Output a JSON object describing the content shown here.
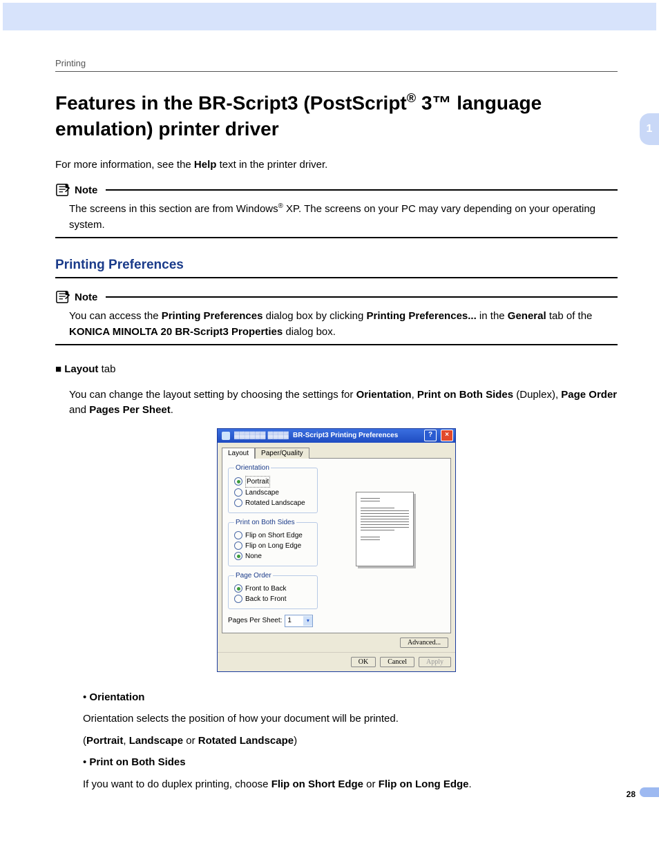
{
  "section_label": "Printing",
  "chapter_number": "1",
  "page_number": "28",
  "main_title_html": "Features in the BR-Script3 (PostScript<sup class='sup'>®</sup> 3™ language emulation) printer driver",
  "intro_html": "For more information, see the <b>Help</b> text in the printer driver.",
  "note1_label": "Note",
  "note1_body_html": "The screens in this section are from Windows<sup class='sup'>®</sup> XP. The screens on your PC may vary depending on your operating system.",
  "sub_title": "Printing Preferences",
  "note2_label": "Note",
  "note2_body_html": "You can access the <b>Printing Preferences</b> dialog box by clicking <b>Printing Preferences...</b> in the <b>General</b> tab of the <b>KONICA MINOLTA 20 BR-Script3 Properties</b> dialog box.",
  "layout_tab_heading_html": "<b>Layout</b> tab",
  "layout_tab_body_html": "You can change the layout setting by choosing the settings for <b>Orientation</b>, <b>Print on Both Sides</b> (Duplex), <b>Page Order</b> and <b>Pages Per Sheet</b>.",
  "dlg": {
    "title": "BR-Script3 Printing Preferences",
    "tabs": {
      "layout": "Layout",
      "paper": "Paper/Quality"
    },
    "orientation": {
      "legend": "Orientation",
      "options": [
        "Portrait",
        "Landscape",
        "Rotated Landscape"
      ],
      "selected": "Portrait"
    },
    "both_sides": {
      "legend": "Print on Both Sides",
      "options": [
        "Flip on Short Edge",
        "Flip on Long Edge",
        "None"
      ],
      "selected": "None"
    },
    "page_order": {
      "legend": "Page Order",
      "options": [
        "Front to Back",
        "Back to Front"
      ],
      "selected": "Front to Back"
    },
    "pps_label": "Pages Per Sheet:",
    "pps_value": "1",
    "advanced": "Advanced...",
    "ok": "OK",
    "cancel": "Cancel",
    "apply": "Apply"
  },
  "bullets": {
    "orientation_title": "Orientation",
    "orientation_body": "Orientation selects the position of how your document will be printed.",
    "orientation_opts_html": "(<b>Portrait</b>, <b>Landscape</b> or <b>Rotated Landscape</b>)",
    "bothsides_title": "Print on Both Sides",
    "bothsides_body_html": "If you want to do duplex printing, choose <b>Flip on Short Edge</b> or <b>Flip on Long Edge</b>."
  }
}
